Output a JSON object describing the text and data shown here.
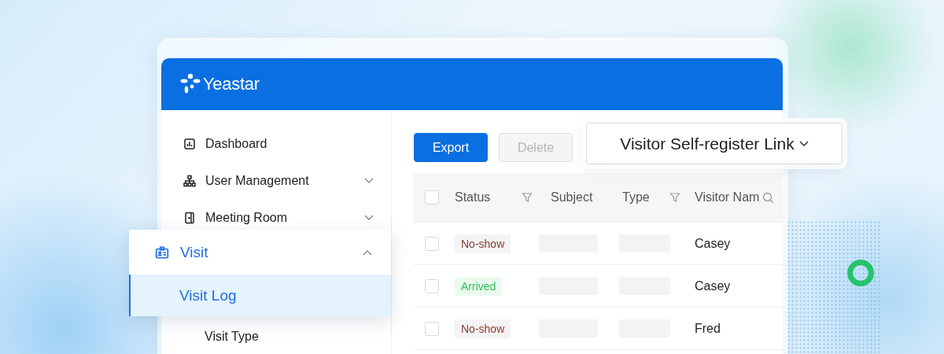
{
  "brand": {
    "name": "Yeastar"
  },
  "sidebar": {
    "items": [
      {
        "label": "Dashboard"
      },
      {
        "label": "User Management",
        "expanded": false
      },
      {
        "label": "Meeting Room",
        "expanded": false
      },
      {
        "label": "Visit",
        "expanded": true,
        "children": [
          {
            "label": "Visit Log",
            "selected": true
          },
          {
            "label": "Visit Type",
            "selected": false
          }
        ]
      }
    ]
  },
  "toolbar": {
    "buttons": [
      {
        "label": "Export",
        "disabled": false
      },
      {
        "label": "Delete",
        "disabled": true
      }
    ],
    "link_dropdown": {
      "label": "Visitor Self-register Link"
    }
  },
  "table": {
    "header_checkbox": {
      "checked": false
    },
    "columns": [
      {
        "label": "Status",
        "kind": "filter"
      },
      {
        "label": "Subject",
        "kind": "plain"
      },
      {
        "label": "Type",
        "kind": "filter"
      },
      {
        "label": "Visitor Nam",
        "kind": "search"
      }
    ],
    "rows": [
      {
        "checked": false,
        "status": {
          "label": "No-show",
          "kind": "neutral"
        },
        "visitor_name": "Casey"
      },
      {
        "checked": false,
        "status": {
          "label": "Arrived",
          "kind": "success"
        },
        "visitor_name": "Casey"
      },
      {
        "checked": false,
        "status": {
          "label": "No-show",
          "kind": "neutral"
        },
        "visitor_name": "Fred"
      }
    ]
  }
}
